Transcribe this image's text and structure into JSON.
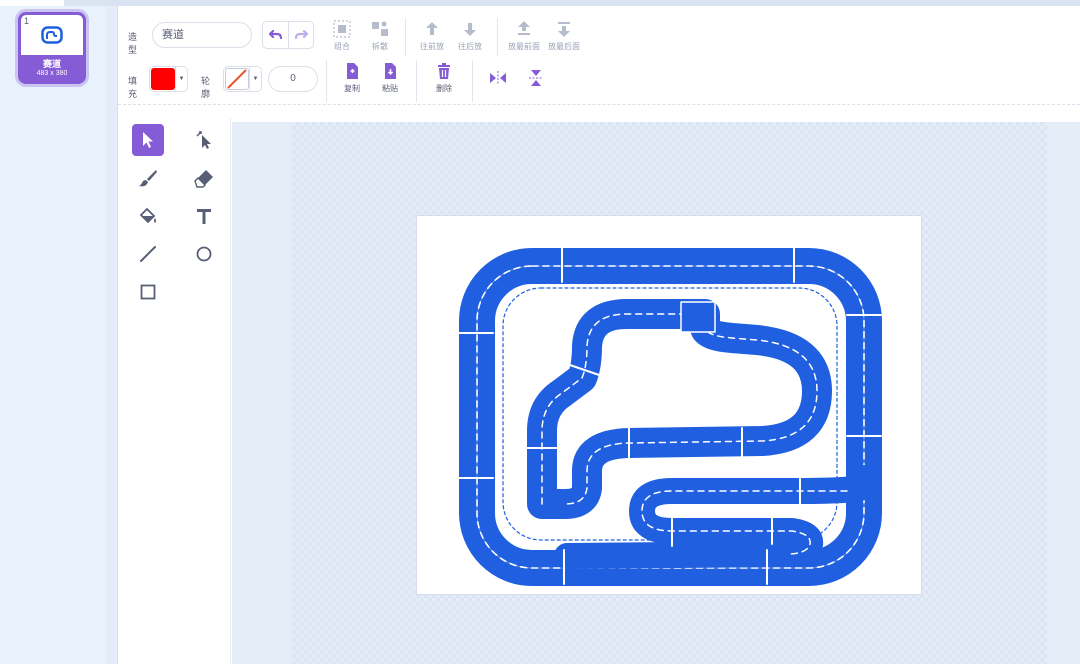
{
  "costume": {
    "number": "1",
    "name": "赛道",
    "size": "483 x 380"
  },
  "toolbar": {
    "costume_label": "造型",
    "costume_name": "赛道",
    "group_label": "组合",
    "ungroup_label": "拆散",
    "forward_label": "往前放",
    "backward_label": "往后放",
    "front_label": "放最前面",
    "back_label": "放最后面",
    "fill_label": "填充",
    "outline_label": "轮廓",
    "outline_width": "0",
    "copy_label": "复制",
    "paste_label": "粘贴",
    "delete_label": "删除"
  },
  "colors": {
    "accent": "#855cd6",
    "fill": "#ff0000",
    "track": "#1f5fe0",
    "icon": "#575e75"
  },
  "tools": [
    "select-icon",
    "reshape-icon",
    "brush-icon",
    "eraser-icon",
    "fill-icon",
    "text-icon",
    "line-icon",
    "circle-icon",
    "rectangle-icon"
  ]
}
